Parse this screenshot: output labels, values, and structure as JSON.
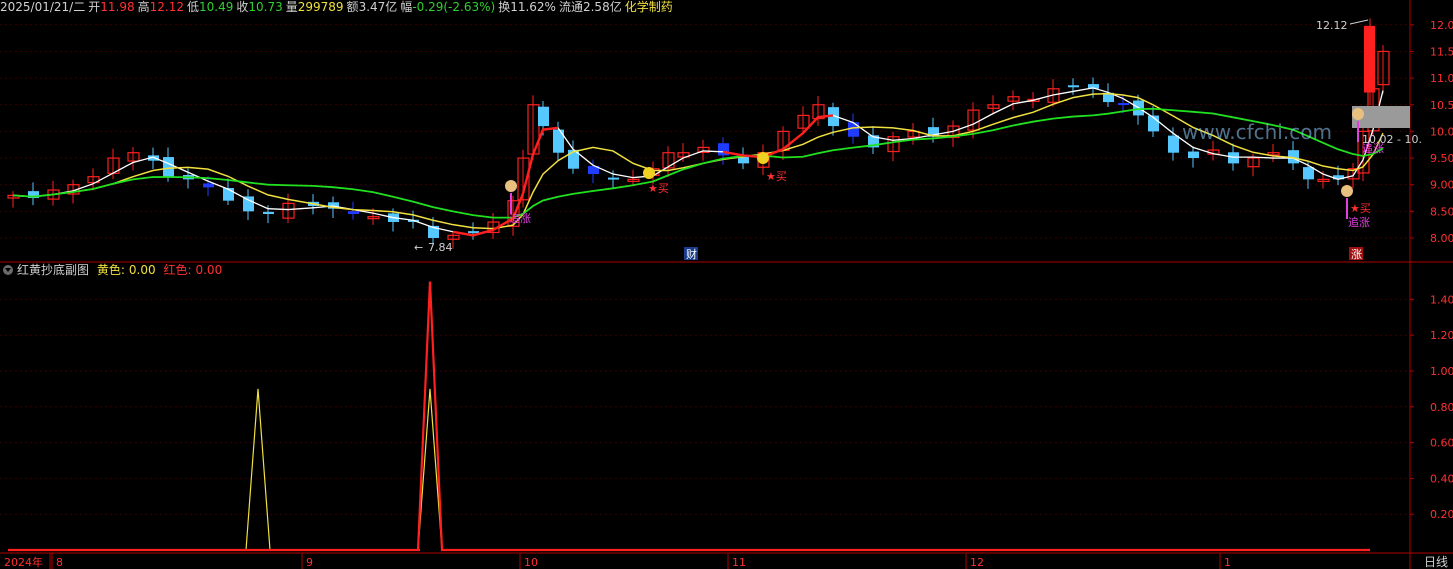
{
  "info_bar": {
    "date": "2025/01/21/二",
    "open_label": "开",
    "open": "11.98",
    "high_label": "高",
    "high": "12.12",
    "low_label": "低",
    "low": "10.49",
    "close_label": "收",
    "close": "10.73",
    "volume_label": "量",
    "volume": "299789",
    "amount_label": "额",
    "amount": "3.47亿",
    "change_label": "幅",
    "change": "-0.29(-2.63%)",
    "turnover_label": "换",
    "turnover": "11.62%",
    "float_label": "流通",
    "float": "2.58亿",
    "name": "化学制药"
  },
  "colors": {
    "up": "#ff2020",
    "down": "#54c8ff",
    "down_dark": "#1f3cff",
    "ma5": "#ffffff",
    "ma10": "#f0e040",
    "ma20": "#20e020",
    "grid": "#3a0000",
    "axis": "#b00000",
    "label_red": "#ff3030",
    "magenta": "#e040e0"
  },
  "main_chart": {
    "y_ticks": [
      "12.00",
      "11.50",
      "11.00",
      "10.50",
      "10.00",
      "9.50",
      "9.00",
      "8.50",
      "8.00"
    ],
    "high_marker": "12.12",
    "low_marker": "7.84",
    "price_box": "10.02 - 10.",
    "watermark": "www.cfchi.com",
    "signals": [
      {
        "text": "追涨",
        "kind": "chase"
      },
      {
        "text": "★买",
        "kind": "buy"
      },
      {
        "text": "★买",
        "kind": "buy"
      },
      {
        "text": "★买",
        "kind": "buy"
      },
      {
        "text": "追涨",
        "kind": "chase"
      },
      {
        "text": "追涨",
        "kind": "chase"
      }
    ],
    "badge_cai": "财",
    "badge_zhang": "涨"
  },
  "sub_chart": {
    "title": "红黄抄底副图",
    "yellow_label": "黄色:",
    "yellow_value": "0.00",
    "red_label": "红色:",
    "red_value": "0.00",
    "y_ticks": [
      "1.40",
      "1.20",
      "1.00",
      "0.80",
      "0.60",
      "0.40",
      "0.20"
    ],
    "chart_data": {
      "type": "line",
      "x": [
        "8",
        "9",
        "10",
        "11",
        "12",
        "1"
      ],
      "series": [
        {
          "name": "黄色",
          "values": [
            0,
            0,
            0.9,
            0,
            0,
            0.9,
            0,
            0,
            0,
            0
          ]
        },
        {
          "name": "红色",
          "values": [
            0,
            0,
            0,
            0,
            0,
            1.5,
            0,
            0,
            0,
            0
          ]
        }
      ],
      "ylim": [
        0,
        1.55
      ]
    }
  },
  "x_axis": {
    "labels": [
      "2024年",
      "8",
      "9",
      "10",
      "11",
      "12",
      "1"
    ]
  },
  "period_button": "日线"
}
